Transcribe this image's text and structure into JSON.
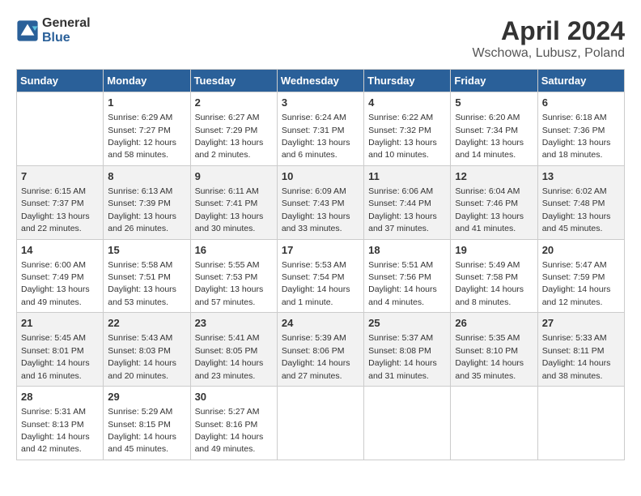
{
  "header": {
    "logo_line1": "General",
    "logo_line2": "Blue",
    "title": "April 2024",
    "subtitle": "Wschowa, Lubusz, Poland"
  },
  "columns": [
    "Sunday",
    "Monday",
    "Tuesday",
    "Wednesday",
    "Thursday",
    "Friday",
    "Saturday"
  ],
  "weeks": [
    [
      {
        "day": "",
        "info": ""
      },
      {
        "day": "1",
        "info": "Sunrise: 6:29 AM\nSunset: 7:27 PM\nDaylight: 12 hours\nand 58 minutes."
      },
      {
        "day": "2",
        "info": "Sunrise: 6:27 AM\nSunset: 7:29 PM\nDaylight: 13 hours\nand 2 minutes."
      },
      {
        "day": "3",
        "info": "Sunrise: 6:24 AM\nSunset: 7:31 PM\nDaylight: 13 hours\nand 6 minutes."
      },
      {
        "day": "4",
        "info": "Sunrise: 6:22 AM\nSunset: 7:32 PM\nDaylight: 13 hours\nand 10 minutes."
      },
      {
        "day": "5",
        "info": "Sunrise: 6:20 AM\nSunset: 7:34 PM\nDaylight: 13 hours\nand 14 minutes."
      },
      {
        "day": "6",
        "info": "Sunrise: 6:18 AM\nSunset: 7:36 PM\nDaylight: 13 hours\nand 18 minutes."
      }
    ],
    [
      {
        "day": "7",
        "info": "Sunrise: 6:15 AM\nSunset: 7:37 PM\nDaylight: 13 hours\nand 22 minutes."
      },
      {
        "day": "8",
        "info": "Sunrise: 6:13 AM\nSunset: 7:39 PM\nDaylight: 13 hours\nand 26 minutes."
      },
      {
        "day": "9",
        "info": "Sunrise: 6:11 AM\nSunset: 7:41 PM\nDaylight: 13 hours\nand 30 minutes."
      },
      {
        "day": "10",
        "info": "Sunrise: 6:09 AM\nSunset: 7:43 PM\nDaylight: 13 hours\nand 33 minutes."
      },
      {
        "day": "11",
        "info": "Sunrise: 6:06 AM\nSunset: 7:44 PM\nDaylight: 13 hours\nand 37 minutes."
      },
      {
        "day": "12",
        "info": "Sunrise: 6:04 AM\nSunset: 7:46 PM\nDaylight: 13 hours\nand 41 minutes."
      },
      {
        "day": "13",
        "info": "Sunrise: 6:02 AM\nSunset: 7:48 PM\nDaylight: 13 hours\nand 45 minutes."
      }
    ],
    [
      {
        "day": "14",
        "info": "Sunrise: 6:00 AM\nSunset: 7:49 PM\nDaylight: 13 hours\nand 49 minutes."
      },
      {
        "day": "15",
        "info": "Sunrise: 5:58 AM\nSunset: 7:51 PM\nDaylight: 13 hours\nand 53 minutes."
      },
      {
        "day": "16",
        "info": "Sunrise: 5:55 AM\nSunset: 7:53 PM\nDaylight: 13 hours\nand 57 minutes."
      },
      {
        "day": "17",
        "info": "Sunrise: 5:53 AM\nSunset: 7:54 PM\nDaylight: 14 hours\nand 1 minute."
      },
      {
        "day": "18",
        "info": "Sunrise: 5:51 AM\nSunset: 7:56 PM\nDaylight: 14 hours\nand 4 minutes."
      },
      {
        "day": "19",
        "info": "Sunrise: 5:49 AM\nSunset: 7:58 PM\nDaylight: 14 hours\nand 8 minutes."
      },
      {
        "day": "20",
        "info": "Sunrise: 5:47 AM\nSunset: 7:59 PM\nDaylight: 14 hours\nand 12 minutes."
      }
    ],
    [
      {
        "day": "21",
        "info": "Sunrise: 5:45 AM\nSunset: 8:01 PM\nDaylight: 14 hours\nand 16 minutes."
      },
      {
        "day": "22",
        "info": "Sunrise: 5:43 AM\nSunset: 8:03 PM\nDaylight: 14 hours\nand 20 minutes."
      },
      {
        "day": "23",
        "info": "Sunrise: 5:41 AM\nSunset: 8:05 PM\nDaylight: 14 hours\nand 23 minutes."
      },
      {
        "day": "24",
        "info": "Sunrise: 5:39 AM\nSunset: 8:06 PM\nDaylight: 14 hours\nand 27 minutes."
      },
      {
        "day": "25",
        "info": "Sunrise: 5:37 AM\nSunset: 8:08 PM\nDaylight: 14 hours\nand 31 minutes."
      },
      {
        "day": "26",
        "info": "Sunrise: 5:35 AM\nSunset: 8:10 PM\nDaylight: 14 hours\nand 35 minutes."
      },
      {
        "day": "27",
        "info": "Sunrise: 5:33 AM\nSunset: 8:11 PM\nDaylight: 14 hours\nand 38 minutes."
      }
    ],
    [
      {
        "day": "28",
        "info": "Sunrise: 5:31 AM\nSunset: 8:13 PM\nDaylight: 14 hours\nand 42 minutes."
      },
      {
        "day": "29",
        "info": "Sunrise: 5:29 AM\nSunset: 8:15 PM\nDaylight: 14 hours\nand 45 minutes."
      },
      {
        "day": "30",
        "info": "Sunrise: 5:27 AM\nSunset: 8:16 PM\nDaylight: 14 hours\nand 49 minutes."
      },
      {
        "day": "",
        "info": ""
      },
      {
        "day": "",
        "info": ""
      },
      {
        "day": "",
        "info": ""
      },
      {
        "day": "",
        "info": ""
      }
    ]
  ]
}
